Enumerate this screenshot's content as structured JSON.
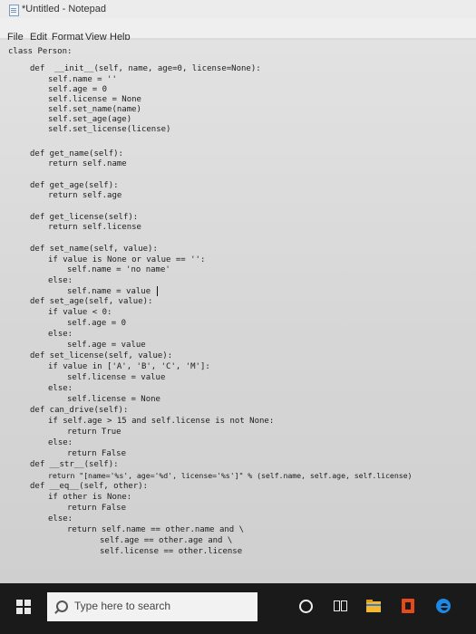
{
  "window": {
    "title": "*Untitled - Notepad"
  },
  "menu": [
    "File",
    "Edit",
    "Format",
    "View",
    "Help"
  ],
  "code_lines": [
    "class Person:",
    "def  __init__(self, name, age=0, license=None):",
    "self.name = ''",
    "self.age = 0",
    "self.license = None",
    "self.set_name(name)",
    "self.set_age(age)",
    "self.set_license(license)",
    "def get_name(self):",
    "return self.name",
    "def get_age(self):",
    "return self.age",
    "def get_license(self):",
    "return self.license",
    "def set_name(self, value):",
    "if value is None or value == '':",
    "self.name = 'no name'",
    "else:",
    "self.name = value",
    "def set_age(self, value):",
    "if value < 0:",
    "self.age = 0",
    "else:",
    "self.age = value",
    "def set_license(self, value):",
    "if value in ['A', 'B', 'C', 'M']:",
    "self.license = value",
    "else:",
    "self.license = None",
    "def can_drive(self):",
    "if self.age > 15 and self.license is not None:",
    "return True",
    "else:",
    "return False",
    "def __str__(self):",
    "return \"[name='%s', age='%d', license='%s']\" % (self.name, self.age, self.license)",
    "def __eq__(self, other):",
    "if other is None:",
    "return False",
    "else:",
    "return self.name == other.name and \\",
    "self.age == other.age and \\",
    "self.license == other.license"
  ],
  "taskbar": {
    "search_placeholder": "Type here to search",
    "icons": [
      "windows-start-icon",
      "search-icon",
      "cortana-icon",
      "task-view-icon",
      "file-explorer-icon",
      "office-icon",
      "edge-icon"
    ]
  },
  "colors": {
    "taskbar": "#1a1a1a",
    "editor_bg": "#d7d7d7",
    "text": "#1c1c1c",
    "explorer": "#f3b830",
    "office": "#e64a19",
    "edge": "#1e88e5"
  }
}
